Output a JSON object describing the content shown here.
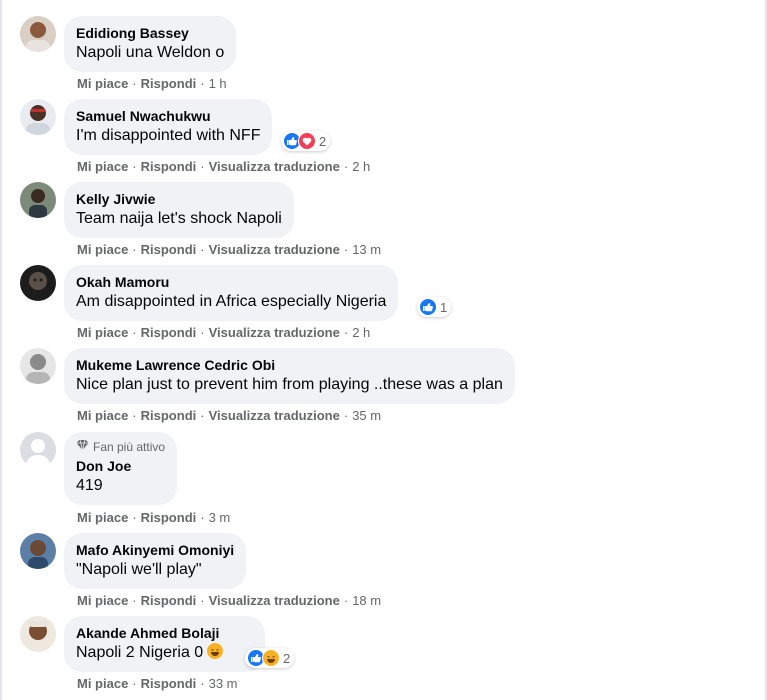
{
  "colors": {
    "bubble_bg": "#f0f2f5",
    "meta_text": "#65676b",
    "like_blue": "#1877f2",
    "love_red": "#f33e58",
    "haha_yellow": "#f7b125"
  },
  "actions": {
    "like": "Mi piace",
    "reply": "Rispondi",
    "translate": "Visualizza traduzione",
    "separator": "·"
  },
  "comments": [
    {
      "author": "Edidiong Bassey",
      "text": "Napoli una Weldon o",
      "time": "1 h",
      "translate": false,
      "reactions": null
    },
    {
      "author": "Samuel Nwachukwu",
      "text": "I'm disappointed with NFF",
      "time": "2 h",
      "translate": true,
      "reactions": {
        "icons": [
          "like-icon",
          "love-icon"
        ],
        "count": "2"
      }
    },
    {
      "author": "Kelly Jivwie",
      "text": "Team naija let's shock Napoli",
      "time": "13 m",
      "translate": true,
      "reactions": null
    },
    {
      "author": "Okah Mamoru",
      "text": "Am disappointed in Africa especially Nigeria",
      "time": "2 h",
      "translate": true,
      "reactions": {
        "icons": [
          "like-icon"
        ],
        "count": "1"
      }
    },
    {
      "author": "Mukeme Lawrence Cedric Obi",
      "text": "Nice plan just to prevent him from playing ..these was a plan",
      "time": "35 m",
      "translate": true,
      "reactions": null
    },
    {
      "author": "Don Joe",
      "badge": "Fan più attivo",
      "text": "419",
      "time": "3 m",
      "translate": false,
      "reactions": null
    },
    {
      "author": "Mafo Akinyemi Omoniyi",
      "text": "\"Napoli we'll play\"",
      "time": "18 m",
      "translate": true,
      "reactions": null
    },
    {
      "author": "Akande Ahmed Bolaji",
      "text": "Napoli 2 Nigeria 0",
      "inline_emoji": "laughing-emoji",
      "time": "33 m",
      "translate": false,
      "reactions": {
        "icons": [
          "like-icon",
          "haha-icon"
        ],
        "count": "2"
      }
    }
  ]
}
